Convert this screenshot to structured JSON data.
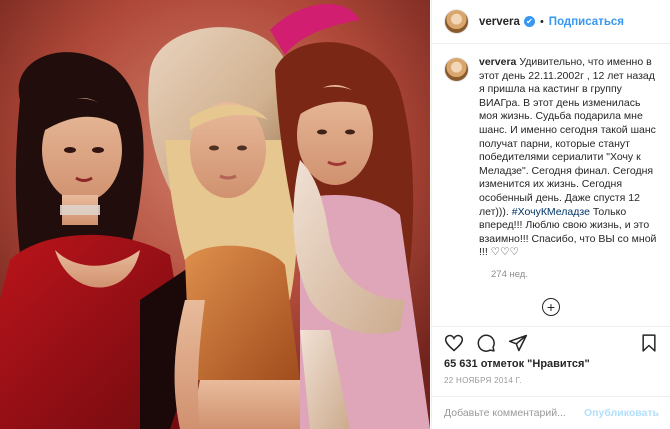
{
  "post": {
    "username": "ververa",
    "follow_label": "Подписаться",
    "dot": "•",
    "verified_mark": "✔",
    "caption_username": "ververa",
    "caption_part1": "Удивительно, что именно в этот день 22.11.2002г , 12 лет назад я пришла на кастинг в группу ВИАГра. В этот день изменилась моя жизнь. Судьба подарила мне шанс. И именно сегодня такой шанс получат парни, которые станут победителями сериалити \"Хочу к Меладзе\". Сегодня финал. Сегодня изменится их жизнь. Сегодня особенный день. Даже спустя 12 лет))).",
    "caption_hashtag": "#ХочуКМеладзе",
    "caption_part2": " Только вперед!!! Люблю свою жизнь, и это взаимно!!! Спасибо, что ВЫ со мной !!! ♡♡♡",
    "caption_time": "274 нед.",
    "add_symbol": "+",
    "likes": "65 631 отметок \"Нравится\"",
    "date": "22 НОЯБРЯ 2014 Г.",
    "comment_placeholder": "Добавьте комментарий...",
    "publish_label": "Опубликовать"
  },
  "icons": {
    "like": "heart-icon",
    "comment": "comment-icon",
    "share": "share-icon",
    "save": "bookmark-icon",
    "add": "plus-circle-icon"
  },
  "colors": {
    "accent": "#3897f0",
    "publish_disabled": "#b2dffc",
    "border": "#efefef"
  }
}
